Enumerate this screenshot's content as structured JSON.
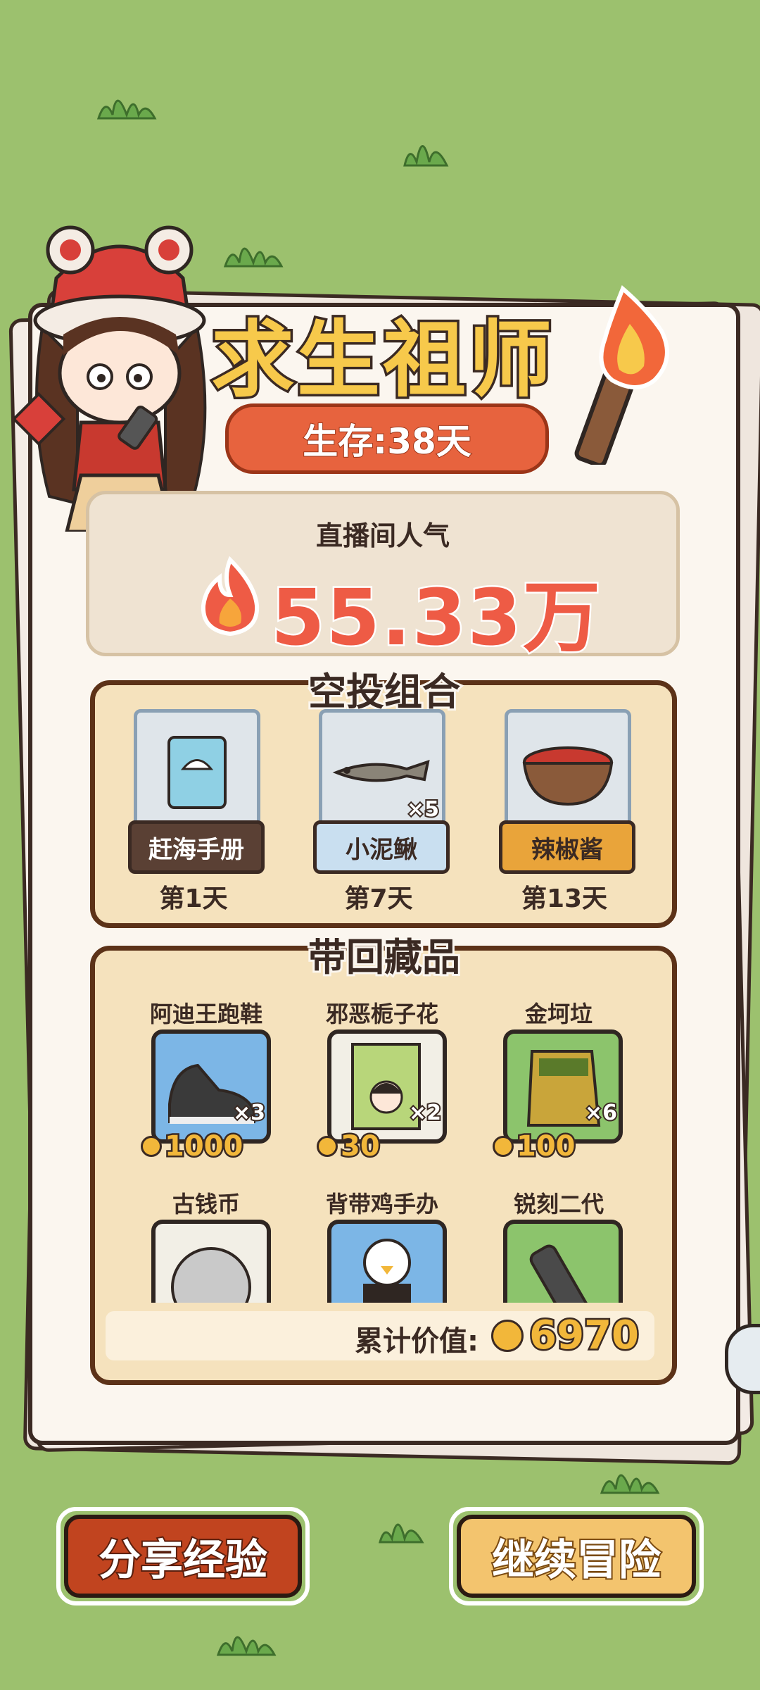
{
  "header": {
    "title": "求生祖师",
    "survival": "生存:38天"
  },
  "popularity": {
    "label": "直播间人气",
    "value": "55.33万"
  },
  "airdrop": {
    "title": "空投组合",
    "items": [
      {
        "name": "赶海手册",
        "day": "第1天",
        "qty": "",
        "label_bg": "#5a4034",
        "label_color": "#ffffff",
        "icon": "shell-book-icon"
      },
      {
        "name": "小泥鳅",
        "day": "第7天",
        "qty": "×5",
        "label_bg": "#c9dff0",
        "label_color": "#3b2a23",
        "icon": "loach-fish-icon"
      },
      {
        "name": "辣椒酱",
        "day": "第13天",
        "qty": "",
        "label_bg": "#e9a43a",
        "label_color": "#3b2a23",
        "icon": "chili-sauce-bowl-icon"
      }
    ]
  },
  "collection": {
    "title": "带回藏品",
    "items": [
      {
        "name": "阿迪王跑鞋",
        "qty": "×3",
        "price": "1000",
        "bg": "#7cb6e6",
        "icon": "sneaker-icon"
      },
      {
        "name": "邪恶栀子花",
        "qty": "×2",
        "price": "30",
        "bg": "#f2efe6",
        "icon": "poster-book-icon"
      },
      {
        "name": "金坷垃",
        "qty": "×6",
        "price": "100",
        "bg": "#8cc46c",
        "icon": "fertilizer-bag-icon"
      },
      {
        "name": "古钱币",
        "qty": "",
        "price": "",
        "bg": "#f2efe6",
        "icon": "coin-face-icon"
      },
      {
        "name": "背带鸡手办",
        "qty": "",
        "price": "",
        "bg": "#7cb6e6",
        "icon": "chicken-figure-icon"
      },
      {
        "name": "锐刻二代",
        "qty": "",
        "price": "",
        "bg": "#8cc46c",
        "icon": "e-cig-icon"
      }
    ],
    "total_label": "累计价值:",
    "total_value": "6970"
  },
  "buttons": {
    "share": "分享经验",
    "continue": "继续冒险"
  },
  "colors": {
    "background": "#9cc16e",
    "accent_orange": "#e7633e",
    "popularity_red": "#ee5b45",
    "gold": "#f2b73a"
  }
}
